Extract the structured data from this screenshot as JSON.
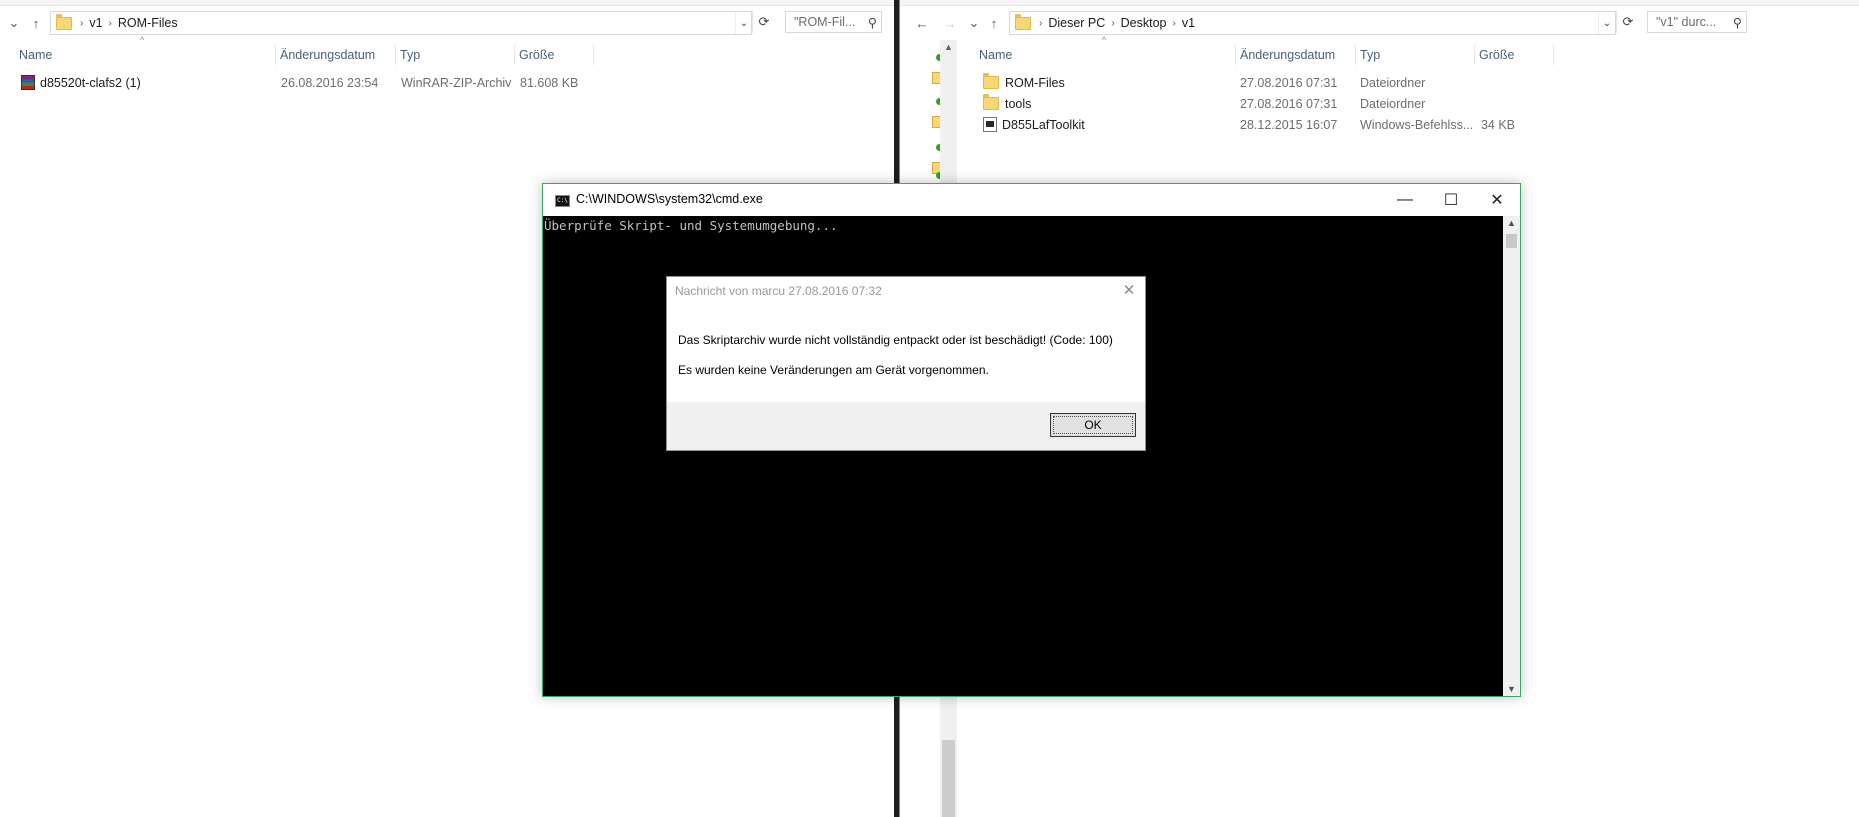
{
  "left_explorer": {
    "breadcrumb": [
      "v1",
      "ROM-Files"
    ],
    "search_placeholder": "\"ROM-Fil...",
    "columns": {
      "name": "Name",
      "date": "Änderungsdatum",
      "type": "Typ",
      "size": "Größe"
    },
    "files": [
      {
        "name": "d85520t-clafs2 (1)",
        "date": "26.08.2016 23:54",
        "type": "WinRAR-ZIP-Archiv",
        "size": "81.608 KB",
        "icon": "winrar-archive-icon"
      }
    ]
  },
  "right_explorer": {
    "breadcrumb": [
      "Dieser PC",
      "Desktop",
      "v1"
    ],
    "search_placeholder": "\"v1\" durc...",
    "columns": {
      "name": "Name",
      "date": "Änderungsdatum",
      "type": "Typ",
      "size": "Größe"
    },
    "files": [
      {
        "name": "ROM-Files",
        "date": "27.08.2016 07:31",
        "type": "Dateiordner",
        "size": "",
        "icon": "folder-icon"
      },
      {
        "name": "tools",
        "date": "27.08.2016 07:31",
        "type": "Dateiordner",
        "size": "",
        "icon": "folder-icon"
      },
      {
        "name": "D855LafToolkit",
        "date": "28.12.2015 16:07",
        "type": "Windows-Befehlss...",
        "size": "34 KB",
        "icon": "batch-file-icon"
      }
    ]
  },
  "cmd_window": {
    "title": "C:\\WINDOWS\\system32\\cmd.exe",
    "icon_text": "C:\\",
    "output": "Überprüfe Skript- und Systemumgebung..."
  },
  "message_box": {
    "title": "Nachricht von marcu 27.08.2016 07:32",
    "line1": "Das Skriptarchiv wurde nicht vollständig entpackt oder ist beschädigt! (Code: 100)",
    "line2": "Es wurden keine Veränderungen am Gerät vorgenommen.",
    "ok_label": "OK"
  },
  "colors": {
    "accent_border": "#3aa864",
    "header_text": "#4c607a",
    "meta_text": "#6d6d6d"
  }
}
